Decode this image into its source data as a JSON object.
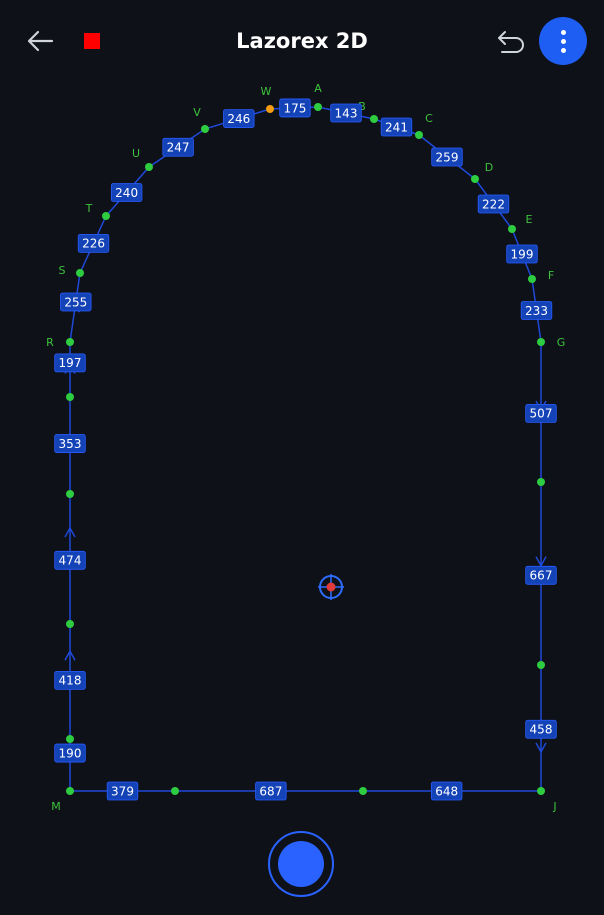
{
  "header": {
    "title": "Lazorex 2D",
    "back_icon": "arrow-left-icon",
    "stop_icon": "stop-icon",
    "undo_icon": "undo-icon",
    "menu_icon": "more-vertical-icon"
  },
  "colors": {
    "background": "#0e1117",
    "path_line": "#1f49d8",
    "label_bg": "#1443b8",
    "point": "#2ecc40",
    "point_label": "#3ec33e",
    "current_point": "#f39c12",
    "accent": "#1f5ef2",
    "stop": "#ff0000",
    "target": "#e03a3a"
  },
  "points": [
    {
      "name": "A"
    },
    {
      "name": "B"
    },
    {
      "name": "C"
    },
    {
      "name": "D"
    },
    {
      "name": "E"
    },
    {
      "name": "F"
    },
    {
      "name": "G"
    },
    {
      "name": ""
    },
    {
      "name": ""
    },
    {
      "name": ""
    },
    {
      "name": "J"
    },
    {
      "name": ""
    },
    {
      "name": ""
    },
    {
      "name": "M"
    },
    {
      "name": ""
    },
    {
      "name": ""
    },
    {
      "name": ""
    },
    {
      "name": "R"
    },
    {
      "name": "S"
    },
    {
      "name": "T"
    },
    {
      "name": "U"
    },
    {
      "name": "V"
    },
    {
      "name": "W"
    }
  ],
  "segments": [
    {
      "from": 0,
      "to": 1,
      "length": "143"
    },
    {
      "from": 1,
      "to": 2,
      "length": "241"
    },
    {
      "from": 2,
      "to": 3,
      "length": "259"
    },
    {
      "from": 3,
      "to": 4,
      "length": "222"
    },
    {
      "from": 4,
      "to": 5,
      "length": "199"
    },
    {
      "from": 5,
      "to": 6,
      "length": "233"
    },
    {
      "from": 6,
      "to": 7,
      "length": "507"
    },
    {
      "from": 7,
      "to": 8,
      "length": "667"
    },
    {
      "from": 8,
      "to": 10,
      "length": "458"
    },
    {
      "from": 10,
      "to": 11,
      "length": "648"
    },
    {
      "from": 11,
      "to": 12,
      "length": "687"
    },
    {
      "from": 12,
      "to": 13,
      "length": "379"
    },
    {
      "from": 13,
      "to": 14,
      "length": "190"
    },
    {
      "from": 14,
      "to": 15,
      "length": "418"
    },
    {
      "from": 15,
      "to": 16,
      "length": "474"
    },
    {
      "from": 16,
      "to": 9,
      "length": "353"
    },
    {
      "from": 9,
      "to": 17,
      "length": "197"
    },
    {
      "from": 17,
      "to": 18,
      "length": "255"
    },
    {
      "from": 18,
      "to": 19,
      "length": "226"
    },
    {
      "from": 19,
      "to": 20,
      "length": "240"
    },
    {
      "from": 20,
      "to": 21,
      "length": "247"
    },
    {
      "from": 21,
      "to": 22,
      "length": "246"
    },
    {
      "from": 22,
      "to": 0,
      "length": "175"
    }
  ],
  "current_point_index": 22,
  "target_icon": "crosshair-target-icon",
  "fab_icon": "record-button-icon"
}
